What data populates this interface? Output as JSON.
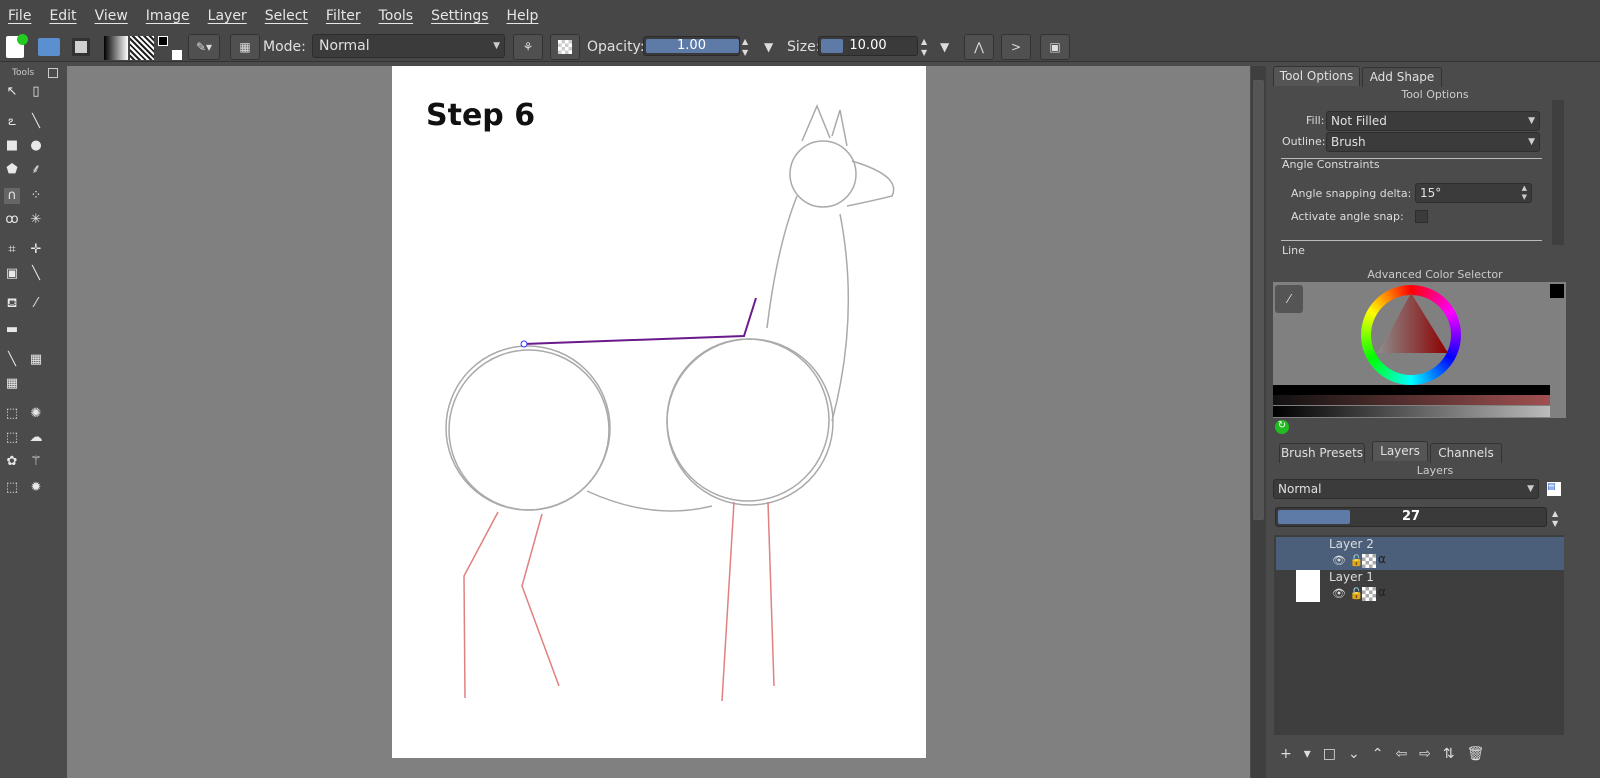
{
  "menu": [
    "File",
    "Edit",
    "View",
    "Image",
    "Layer",
    "Select",
    "Filter",
    "Tools",
    "Settings",
    "Help"
  ],
  "toolbar": {
    "mode_label": "Mode:",
    "mode_value": "Normal",
    "opacity_label": "Opacity:",
    "opacity_value": "1.00",
    "opacity_fraction": 1.0,
    "size_label": "Size:",
    "size_value": "10.00",
    "size_fraction": 0.1
  },
  "toolbox": {
    "title": "Tools"
  },
  "canvas": {
    "heading": "Step 6"
  },
  "tool_options": {
    "tabs": [
      "Tool Options",
      "Add Shape"
    ],
    "title": "Tool Options",
    "fill_label": "Fill:",
    "fill_value": "Not Filled",
    "outline_label": "Outline:",
    "outline_value": "Brush",
    "angle_section": "Angle Constraints",
    "snap_delta_label": "Angle snapping delta:",
    "snap_delta_value": "15°",
    "activate_snap_label": "Activate angle snap:",
    "line_section": "Line"
  },
  "color_selector": {
    "title": "Advanced Color Selector"
  },
  "layers": {
    "tabs": [
      "Brush Presets",
      "Layers",
      "Channels"
    ],
    "title": "Layers",
    "blend_mode": "Normal",
    "opacity_value": "27",
    "opacity_fraction": 0.27,
    "items": [
      {
        "name": "Layer 2",
        "selected": true
      },
      {
        "name": "Layer 1",
        "selected": false
      }
    ]
  }
}
